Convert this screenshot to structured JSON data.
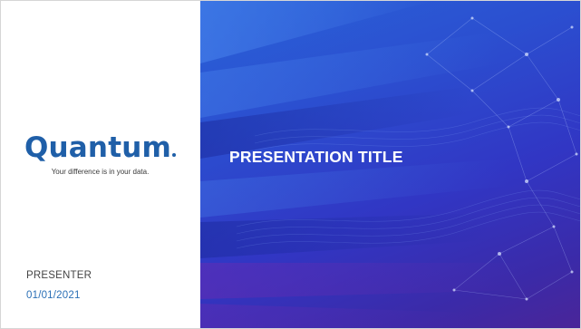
{
  "logo": {
    "wordmark": "Quantum",
    "tagline": "Your difference is in your data."
  },
  "slide": {
    "title": "PRESENTATION TITLE",
    "presenter": "PRESENTER",
    "date": "01/01/2021"
  },
  "colors": {
    "brand": "#1f5fa8",
    "date_text": "#2a6fb6",
    "background_start": "#2a63d8",
    "background_end": "#4a2598"
  },
  "decoration": {
    "background_icon": "network-lines-graphic"
  }
}
